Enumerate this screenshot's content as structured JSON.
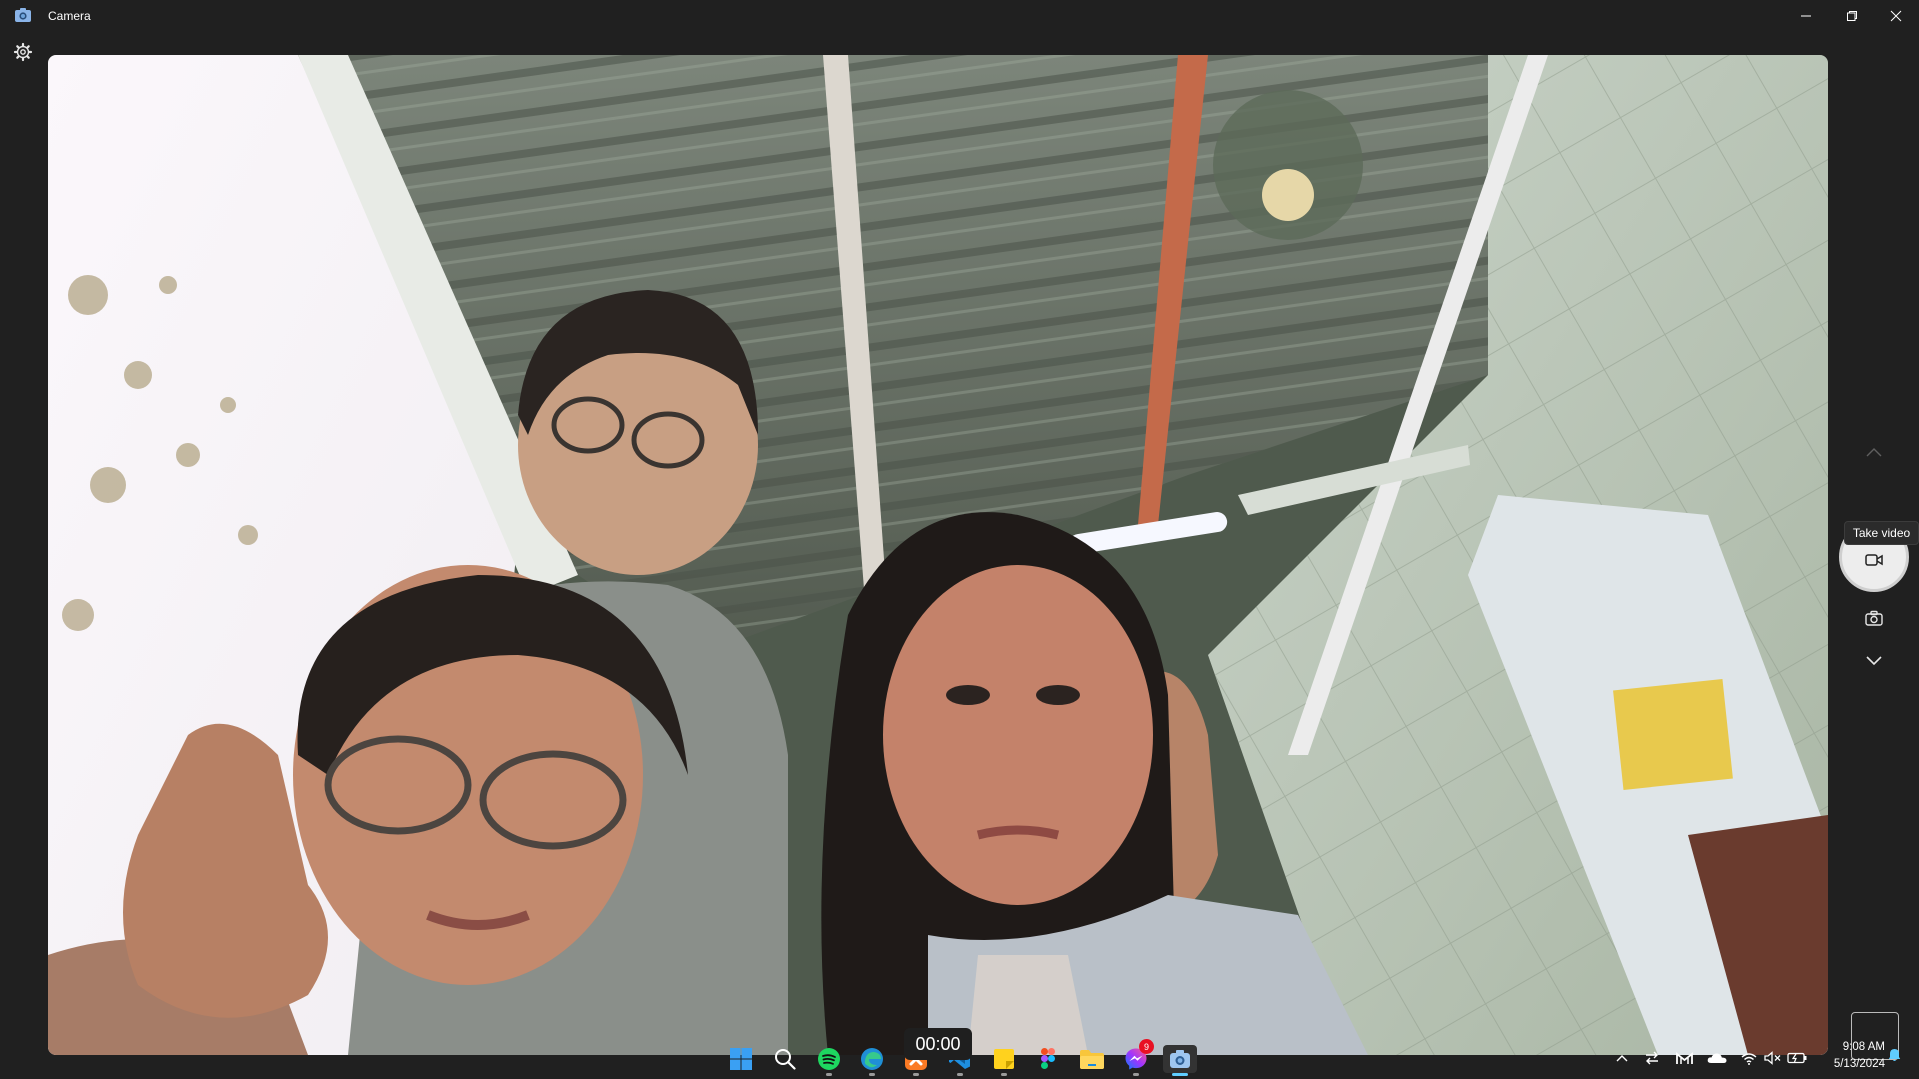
{
  "window": {
    "title": "Camera",
    "controls": [
      "minimize",
      "maximize",
      "close"
    ]
  },
  "toolbar": {
    "settings_icon": "gear-icon"
  },
  "capture": {
    "tooltip": "Take video",
    "mode_up_icon": "chevron-up-icon",
    "video_icon": "video-camera-icon",
    "photo_icon": "camera-icon",
    "mode_down_icon": "chevron-down-icon"
  },
  "recording": {
    "timer": "00:00"
  },
  "taskbar": {
    "apps": [
      {
        "name": "start",
        "icon": "windows-logo-icon"
      },
      {
        "name": "search",
        "icon": "search-icon"
      },
      {
        "name": "spotify",
        "icon": "spotify-icon"
      },
      {
        "name": "edge",
        "icon": "edge-icon"
      },
      {
        "name": "xampp",
        "icon": "xampp-icon"
      },
      {
        "name": "vscode",
        "icon": "vscode-icon"
      },
      {
        "name": "sticky-notes",
        "icon": "sticky-notes-icon"
      },
      {
        "name": "figma",
        "icon": "figma-icon"
      },
      {
        "name": "file-explorer",
        "icon": "folder-icon"
      },
      {
        "name": "messenger",
        "icon": "messenger-icon",
        "badge": "9"
      },
      {
        "name": "camera",
        "icon": "camera-app-icon",
        "active": true
      }
    ],
    "tray": [
      "chevron-up-icon",
      "network-transfer-icon",
      "gmail-icon",
      "onedrive-icon",
      "wifi-icon",
      "volume-muted-icon",
      "battery-icon"
    ],
    "time": "9:08 AM",
    "date": "5/13/2024",
    "notification_icon": "bell-icon"
  },
  "colors": {
    "background": "#202020",
    "accent": "#60cdff",
    "badge": "#e81123"
  }
}
